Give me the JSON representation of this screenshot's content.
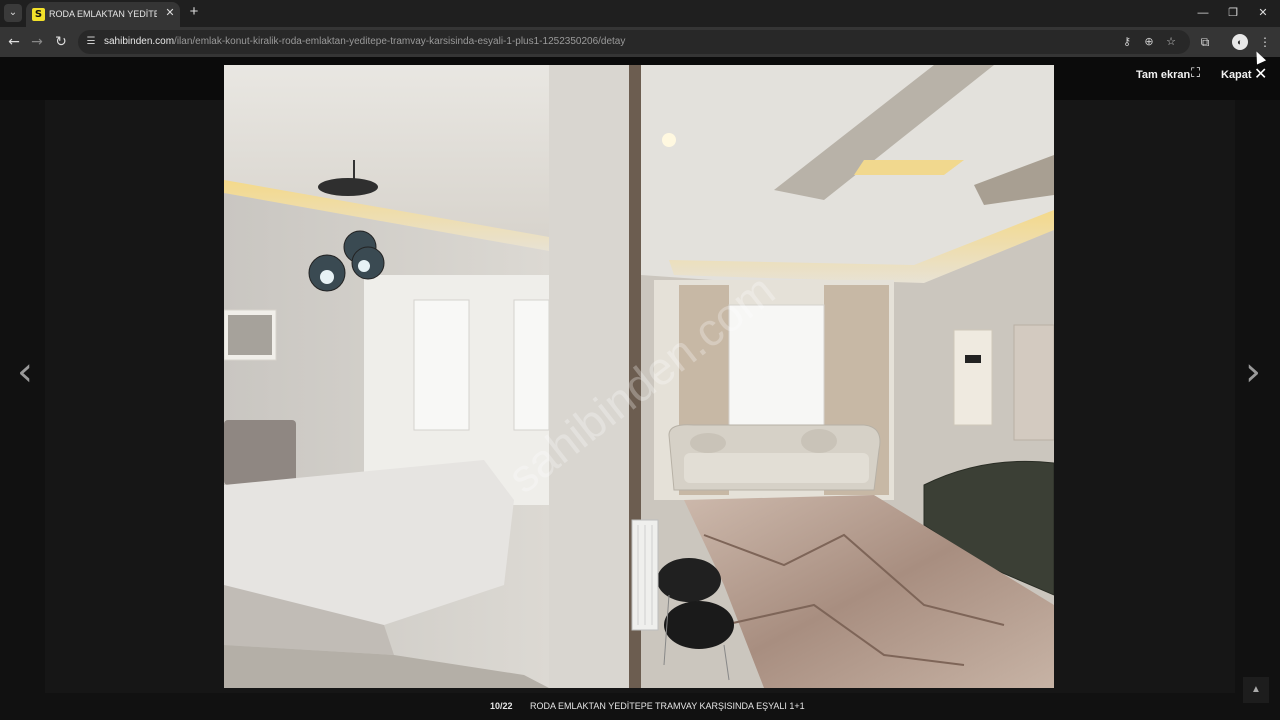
{
  "browser": {
    "tab": {
      "favicon_letter": "S",
      "title": "RODA EMLAKTAN YEDİTEPE TR"
    },
    "url": {
      "host": "sahibinden.com",
      "path": "/ilan/emlak-konut-kiralik-roda-emlaktan-yeditepe-tramvay-karsisinda-esyali-1-plus1-1252350206/detay"
    },
    "icons": {
      "back": "back-arrow-icon",
      "forward": "forward-arrow-icon",
      "reload": "reload-icon",
      "site_info": "tune-icon",
      "password": "key-icon",
      "zoom": "zoom-icon",
      "bookmark": "star-icon",
      "extensions": "puzzle-icon",
      "menu": "kebab-menu-icon"
    }
  },
  "lightbox": {
    "fullscreen_label": "Tam ekran",
    "close_label": "Kapat",
    "counter": "10/22",
    "caption": "RODA EMLAKTAN YEDİTEPE TRAMVAY KARŞISINDA EŞYALI 1+1",
    "watermark": "sahibinden.com"
  },
  "colors": {
    "accent": "#f3e12a",
    "overlay": "#111111"
  }
}
